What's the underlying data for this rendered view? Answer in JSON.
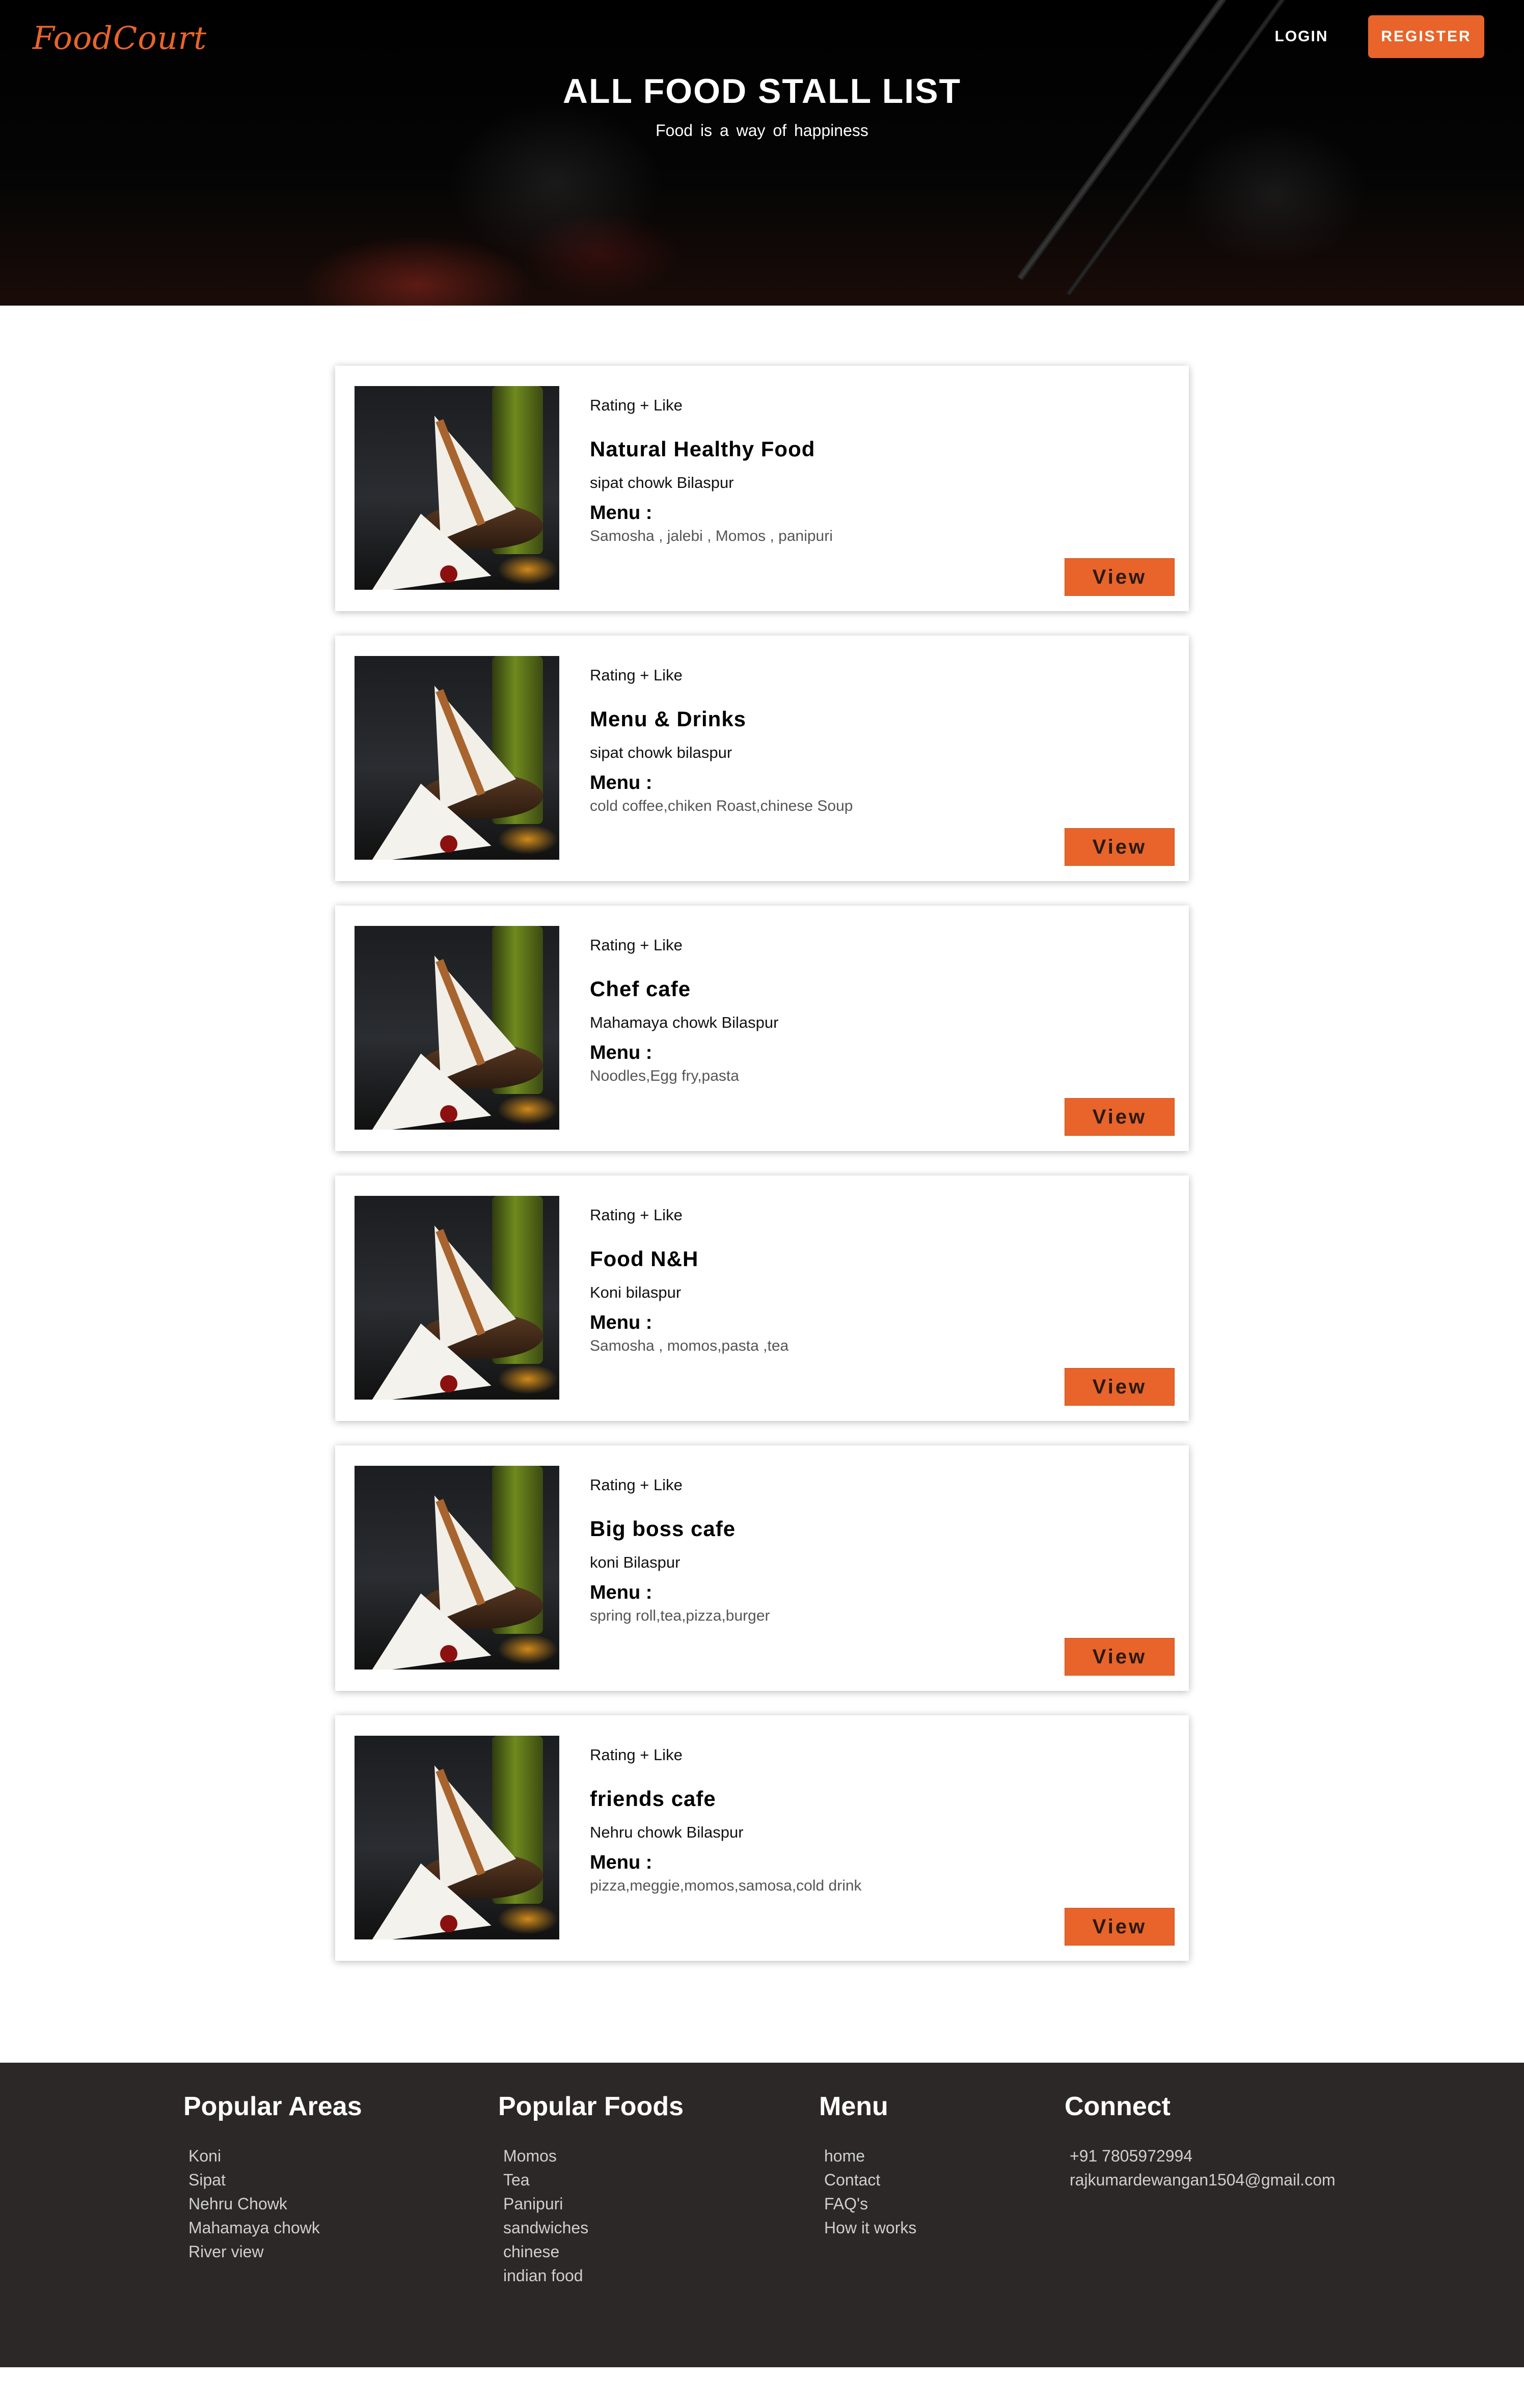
{
  "header": {
    "logo": "FoodCourt",
    "login_label": "LOGIN",
    "register_label": "REGISTER",
    "title": "ALL FOOD STALL LIST",
    "subtitle": "Food is a way of happiness"
  },
  "colors": {
    "accent": "#e8642a",
    "footer_bg": "#2c2827"
  },
  "stalls": [
    {
      "rating": "Rating + Like",
      "name": "Natural Healthy Food",
      "location": "sipat chowk Bilaspur",
      "menu_label": "Menu :",
      "menu": "Samosha , jalebi , Momos , panipuri",
      "view_label": "View"
    },
    {
      "rating": "Rating + Like",
      "name": "Menu & Drinks",
      "location": "sipat chowk bilaspur",
      "menu_label": "Menu :",
      "menu": "cold coffee,chiken Roast,chinese Soup",
      "view_label": "View"
    },
    {
      "rating": "Rating + Like",
      "name": "Chef cafe",
      "location": "Mahamaya chowk Bilaspur",
      "menu_label": "Menu :",
      "menu": "Noodles,Egg fry,pasta",
      "view_label": "View"
    },
    {
      "rating": "Rating + Like",
      "name": "Food N&H",
      "location": "Koni bilaspur",
      "menu_label": "Menu :",
      "menu": "Samosha , momos,pasta ,tea",
      "view_label": "View"
    },
    {
      "rating": "Rating + Like",
      "name": "Big boss cafe",
      "location": "koni Bilaspur",
      "menu_label": "Menu :",
      "menu": "spring roll,tea,pizza,burger",
      "view_label": "View"
    },
    {
      "rating": "Rating + Like",
      "name": "friends cafe",
      "location": "Nehru chowk Bilaspur",
      "menu_label": "Menu :",
      "menu": "pizza,meggie,momos,samosa,cold drink",
      "view_label": "View"
    }
  ],
  "footer": {
    "areas": {
      "title": "Popular Areas",
      "items": [
        "Koni",
        "Sipat",
        "Nehru Chowk",
        "Mahamaya chowk",
        "River view"
      ]
    },
    "foods": {
      "title": "Popular Foods",
      "items": [
        "Momos",
        "Tea",
        "Panipuri",
        "sandwiches",
        "chinese",
        "indian food"
      ]
    },
    "menu": {
      "title": "Menu",
      "items": [
        "home",
        "Contact",
        "FAQ's",
        "How it works"
      ]
    },
    "connect": {
      "title": "Connect",
      "items": [
        "+91 7805972994",
        "rajkumardewangan1504@gmail.com"
      ]
    }
  }
}
